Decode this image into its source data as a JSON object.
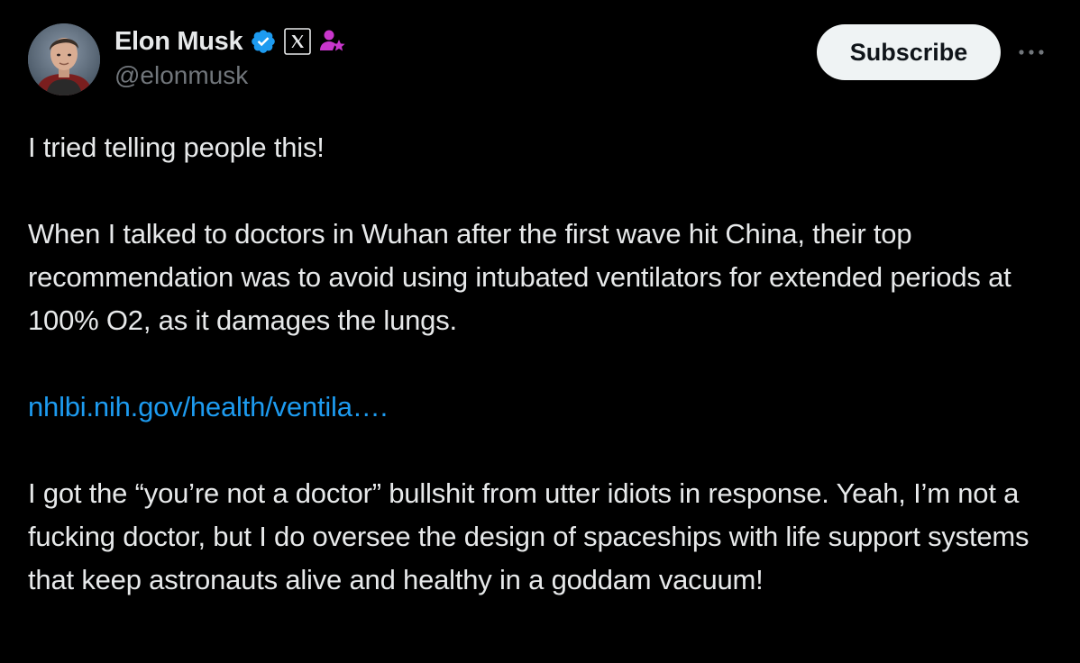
{
  "author": {
    "display_name": "Elon Musk",
    "handle": "@elonmusk",
    "verified_icon": "verified-badge-icon",
    "affiliate_icon": "x-logo-icon",
    "subscriber_icon": "person-star-icon"
  },
  "actions": {
    "subscribe_label": "Subscribe",
    "more_icon": "more-options-icon"
  },
  "tweet": {
    "paragraph_1": "I tried telling people this!",
    "paragraph_2": "When I talked to doctors in Wuhan after the first wave hit China, their top recommendation was to avoid using intubated ventilators for extended periods at 100% O2, as it damages the lungs.",
    "link_text": "nhlbi.nih.gov/health/ventila….",
    "paragraph_4": "I got the “you’re not a doctor” bullshit from utter idiots in response. Yeah, I’m not a fucking doctor, but I do oversee the design of spaceships with life support systems that keep astronauts alive and healthy in a goddam vacuum!"
  },
  "colors": {
    "background": "#000000",
    "text": "#e7e9ea",
    "secondary_text": "#71767b",
    "link": "#1d9bf0",
    "verified_badge": "#1d9bf0",
    "subscriber_icon": "#c936cc",
    "button_bg": "#eff3f4"
  }
}
